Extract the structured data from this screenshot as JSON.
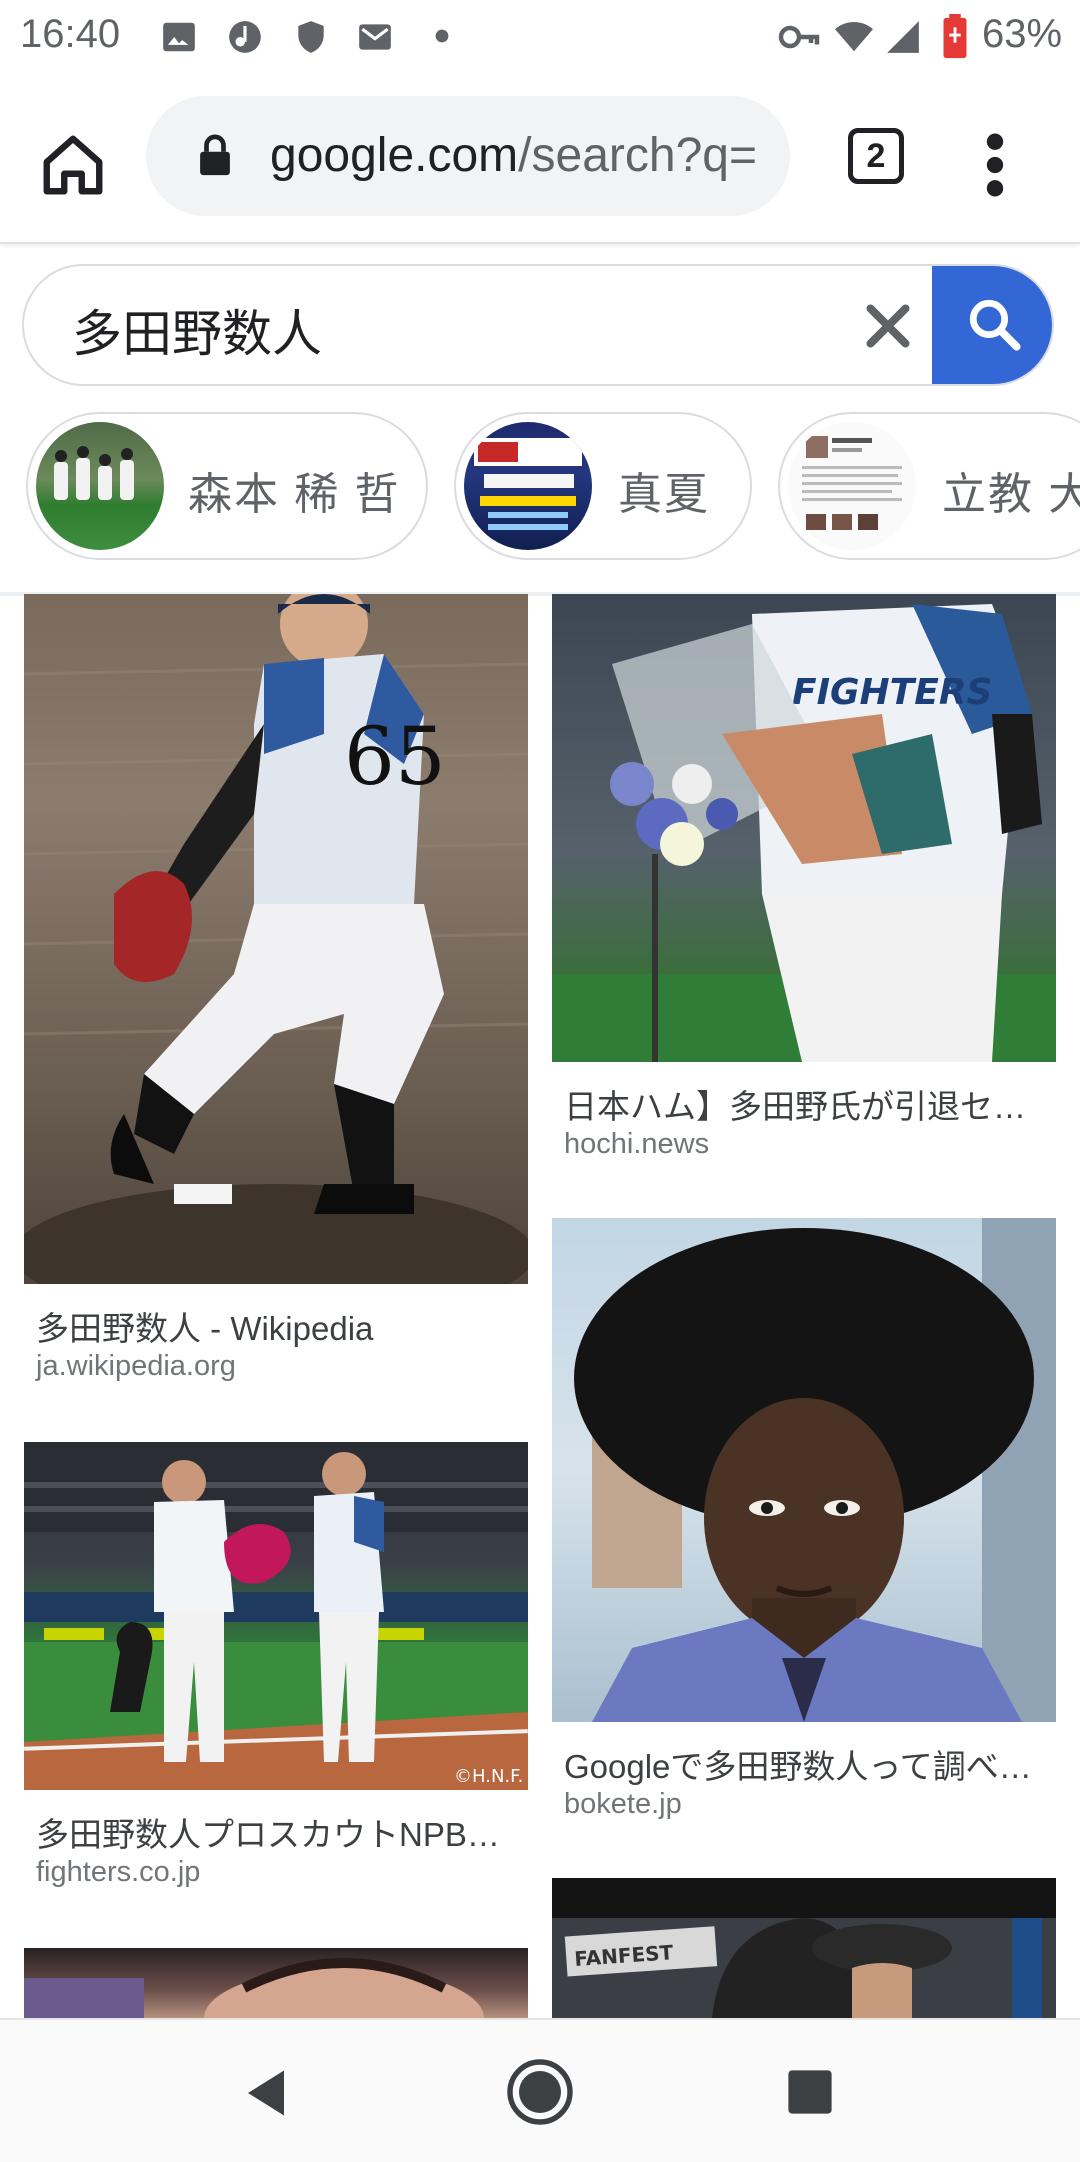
{
  "status_bar": {
    "time": "16:40",
    "battery": "63%",
    "icons": [
      "image-icon",
      "music-icon",
      "shield-icon",
      "mail-icon",
      "dot-icon",
      "key-icon",
      "wifi-icon",
      "signal-icon",
      "battery-icon"
    ]
  },
  "browser": {
    "url_host": "google.com",
    "url_path": "/search?q=",
    "tab_count": "2"
  },
  "search": {
    "query": "多田野数人"
  },
  "chips": [
    {
      "label": "森本 稀 哲"
    },
    {
      "label": "真夏"
    },
    {
      "label": "立教 大"
    }
  ],
  "results": [
    {
      "title": "多田野数人 - Wikipedia",
      "source": "ja.wikipedia.org"
    },
    {
      "title": "日本ハム】多田野氏が引退セ…",
      "source": "hochi.news"
    },
    {
      "title": "多田野数人プロスカウトNPB…",
      "source": "fighters.co.jp"
    },
    {
      "title": "Googleで多田野数人って調べ…",
      "source": "bokete.jp"
    }
  ],
  "colors": {
    "search_button": "#3367d6",
    "field_green": "#3b8a3a"
  }
}
